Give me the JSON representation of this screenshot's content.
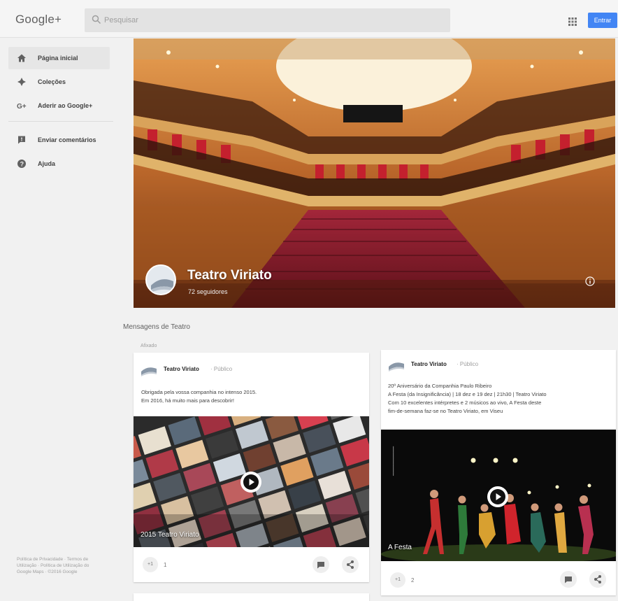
{
  "header": {
    "logo": "Google+",
    "search_placeholder": "Pesquisar",
    "signin_label": "Entrar"
  },
  "sidebar": {
    "items": [
      {
        "label": "Página inicial",
        "icon": "home-icon"
      },
      {
        "label": "Coleções",
        "icon": "collections-icon"
      },
      {
        "label": "Aderir ao Google+",
        "icon": "google-plus-icon"
      },
      {
        "label": "Enviar comentários",
        "icon": "feedback-icon"
      },
      {
        "label": "Ajuda",
        "icon": "help-icon"
      }
    ],
    "footer": "Política de Privacidade · Termos de Utilização · Política de Utilização do Google Maps · ©2016 Google"
  },
  "profile": {
    "name": "Teatro Viriato",
    "followers": "72 seguidores"
  },
  "feed": {
    "section_title": "Mensagens de Teatro",
    "section_sub": "Afixado",
    "posts": [
      {
        "author": "Teatro Viriato",
        "visibility": "· Público",
        "text_lines": [
          "Obrigada pela vossa companhia no intenso 2015.",
          "Em 2016, há muito mais para descobrir!"
        ],
        "media_caption": "2015 Teatro Viriato",
        "plus_count": "1"
      },
      {
        "author": "Teatro Viriato",
        "visibility": "· Público",
        "text_lines": [
          "20º Aniversário da Companhia Paulo Ribeiro",
          "A Festa (da Insignificância) | 18 dez e 19 dez | 21h30 | Teatro Viriato",
          "Com 10 excelentes intérpretes e 2 músicos ao vivo, A Festa deste",
          "fim-de-semana faz-se no Teatro Viriato, em Viseu"
        ],
        "media_caption": "A Festa",
        "plus_count": "2"
      }
    ]
  },
  "colors": {
    "accent": "#4285f4",
    "background": "#f1f1f1"
  }
}
